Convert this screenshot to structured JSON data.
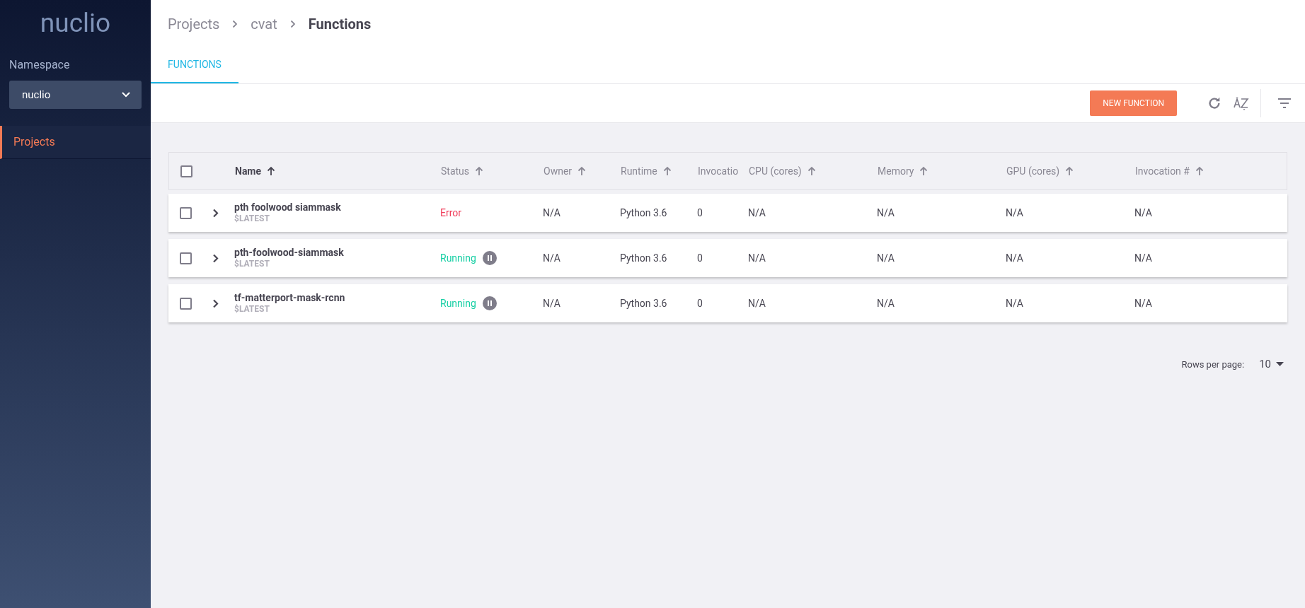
{
  "sidebar": {
    "logo": "nuclio",
    "namespace_label": "Namespace",
    "namespace_value": "nuclio",
    "items": [
      {
        "label": "Projects",
        "selected": true
      }
    ]
  },
  "breadcrumbs": [
    {
      "label": "Projects",
      "current": false
    },
    {
      "label": "cvat",
      "current": false
    },
    {
      "label": "Functions",
      "current": true
    }
  ],
  "tabs": [
    {
      "label": "FUNCTIONS",
      "selected": true
    }
  ],
  "toolbar": {
    "new_button": "NEW FUNCTION"
  },
  "table": {
    "select_all_checked": false,
    "columns": [
      {
        "label": "Name",
        "sorted": true,
        "sort_icon": true
      },
      {
        "label": "Status",
        "sorted": false,
        "sort_icon": true
      },
      {
        "label": "Owner",
        "sorted": false,
        "sort_icon": true
      },
      {
        "label": "Runtime",
        "sorted": false,
        "sort_icon": true
      },
      {
        "label": "Invocatio",
        "sorted": false,
        "sort_icon": false
      },
      {
        "label": "CPU (cores)",
        "sorted": false,
        "sort_icon": true
      },
      {
        "label": "Memory",
        "sorted": false,
        "sort_icon": true
      },
      {
        "label": "GPU (cores)",
        "sorted": false,
        "sort_icon": true
      },
      {
        "label": "Invocation #",
        "sorted": false,
        "sort_icon": true
      }
    ],
    "rows": [
      {
        "checked": false,
        "name": "pth foolwood siammask",
        "version": "$LATEST",
        "status": {
          "label": "Error",
          "kind": "error"
        },
        "owner": "N/A",
        "runtime": "Python 3.6",
        "invocations": "0",
        "cpu": "N/A",
        "memory": "N/A",
        "gpu": "N/A",
        "invocation_count": "N/A"
      },
      {
        "checked": false,
        "name": "pth-foolwood-siammask",
        "version": "$LATEST",
        "status": {
          "label": "Running",
          "kind": "running"
        },
        "owner": "N/A",
        "runtime": "Python 3.6",
        "invocations": "0",
        "cpu": "N/A",
        "memory": "N/A",
        "gpu": "N/A",
        "invocation_count": "N/A"
      },
      {
        "checked": false,
        "name": "tf-matterport-mask-rcnn",
        "version": "$LATEST",
        "status": {
          "label": "Running",
          "kind": "running"
        },
        "owner": "N/A",
        "runtime": "Python 3.6",
        "invocations": "0",
        "cpu": "N/A",
        "memory": "N/A",
        "gpu": "N/A",
        "invocation_count": "N/A"
      }
    ]
  },
  "pagination": {
    "label": "Rows per page:",
    "value": "10"
  }
}
